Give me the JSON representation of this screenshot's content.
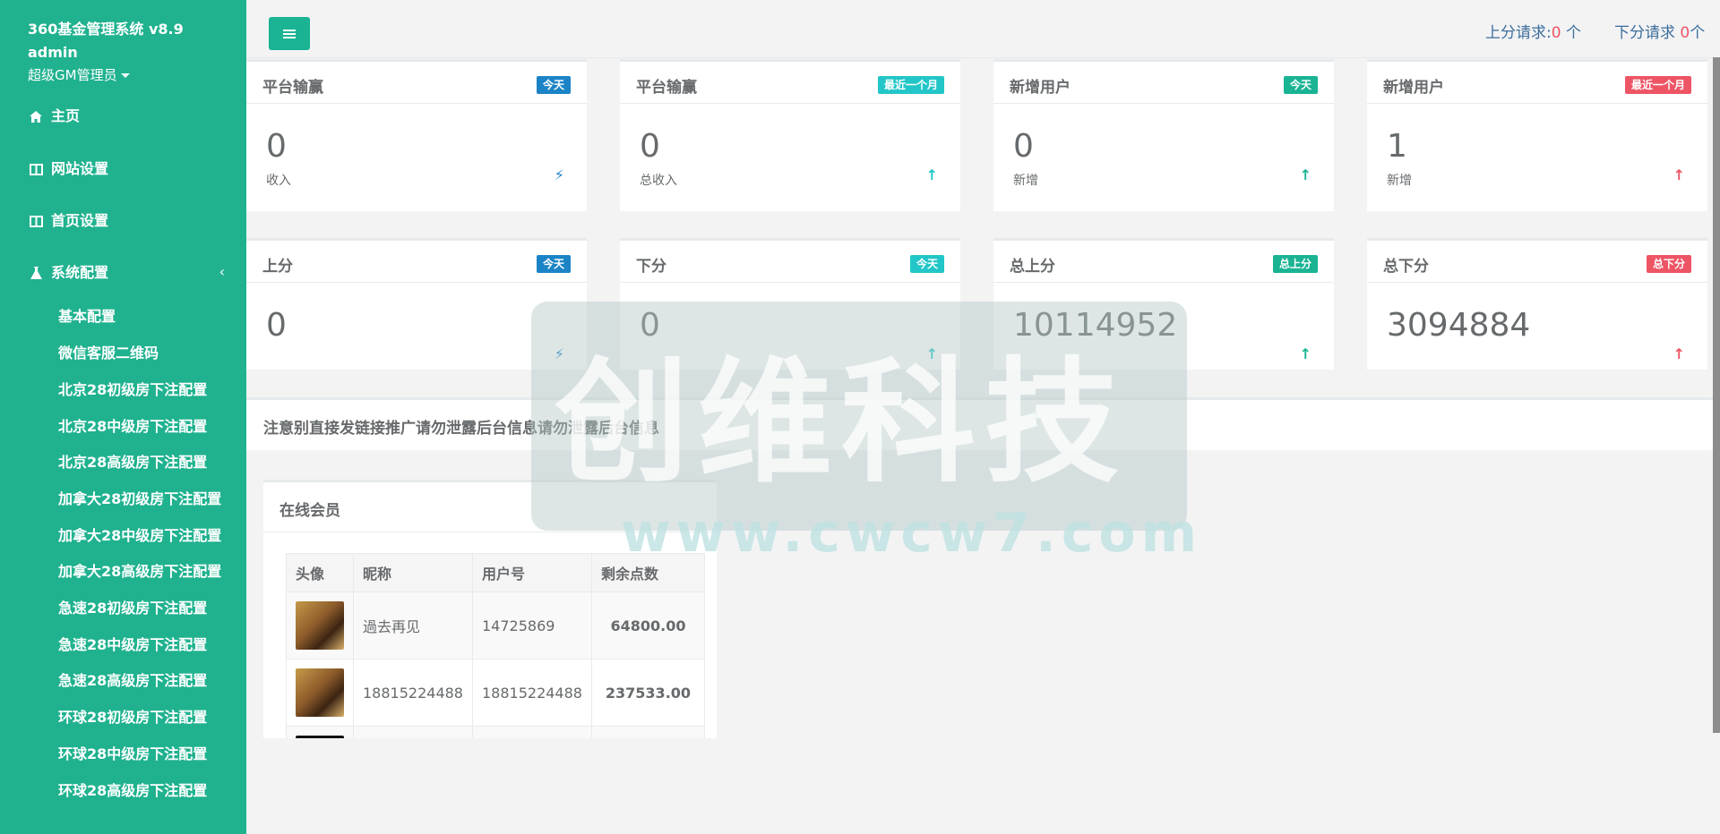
{
  "sidebar": {
    "brand": "360基金管理系统 v8.9",
    "user": "admin",
    "role": "超级GM管理员",
    "nav": [
      {
        "label": "主页",
        "icon": "home-icon"
      },
      {
        "label": "网站设置",
        "icon": "columns-icon"
      },
      {
        "label": "首页设置",
        "icon": "columns-icon"
      },
      {
        "label": "系统配置",
        "icon": "flask-icon"
      }
    ],
    "arrow": "‹",
    "sub": [
      "基本配置",
      "微信客服二维码",
      "北京28初级房下注配置",
      "北京28中级房下注配置",
      "北京28高级房下注配置",
      "加拿大28初级房下注配置",
      "加拿大28中级房下注配置",
      "加拿大28高级房下注配置",
      "急速28初级房下注配置",
      "急速28中级房下注配置",
      "急速28高级房下注配置",
      "环球28初级房下注配置",
      "环球28中级房下注配置",
      "环球28高级房下注配置"
    ]
  },
  "topbar": {
    "up_label": "上分请求:",
    "up_count": "0",
    "up_unit": " 个",
    "down_label": "下分请求 ",
    "down_count": "0",
    "down_unit": "个"
  },
  "stats_row1": [
    {
      "title": "平台输赢",
      "badge": "今天",
      "value": "0",
      "sub": "收入",
      "arrow": "⚡",
      "color": "#1c84c6"
    },
    {
      "title": "平台输赢",
      "badge": "最近一个月",
      "value": "0",
      "sub": "总收入",
      "arrow": "↑",
      "color": "#23c6c8"
    },
    {
      "title": "新增用户",
      "badge": "今天",
      "value": "0",
      "sub": "新增",
      "arrow": "↑",
      "color": "#1ab394"
    },
    {
      "title": "新增用户",
      "badge": "最近一个月",
      "value": "1",
      "sub": "新增",
      "arrow": "↑",
      "color": "#ed5565"
    }
  ],
  "stats_row2": [
    {
      "title": "上分",
      "badge": "今天",
      "value": "0",
      "arrow": "⚡",
      "color": "#1c84c6"
    },
    {
      "title": "下分",
      "badge": "今天",
      "value": "0",
      "arrow": "↑",
      "color": "#23c6c8"
    },
    {
      "title": "总上分",
      "badge": "总上分",
      "value": "10114952",
      "arrow": "↑",
      "color": "#1ab394"
    },
    {
      "title": "总下分",
      "badge": "总下分",
      "value": "3094884",
      "arrow": "↑",
      "color": "#ed5565"
    }
  ],
  "notice": "注意别直接发链接推广请勿泄露后台信息请勿泄露后台信息",
  "online": {
    "title": "在线会员",
    "columns": [
      "头像",
      "昵称",
      "用户号",
      "剩余点数"
    ],
    "rows": [
      {
        "nickname": "過去再见",
        "uid": "14725869",
        "points": "64800.00"
      },
      {
        "nickname": "18815224488",
        "uid": "18815224488",
        "points": "237533.00"
      }
    ]
  },
  "watermark": {
    "text": "创维科技",
    "url": "www.cwcw7.com"
  }
}
